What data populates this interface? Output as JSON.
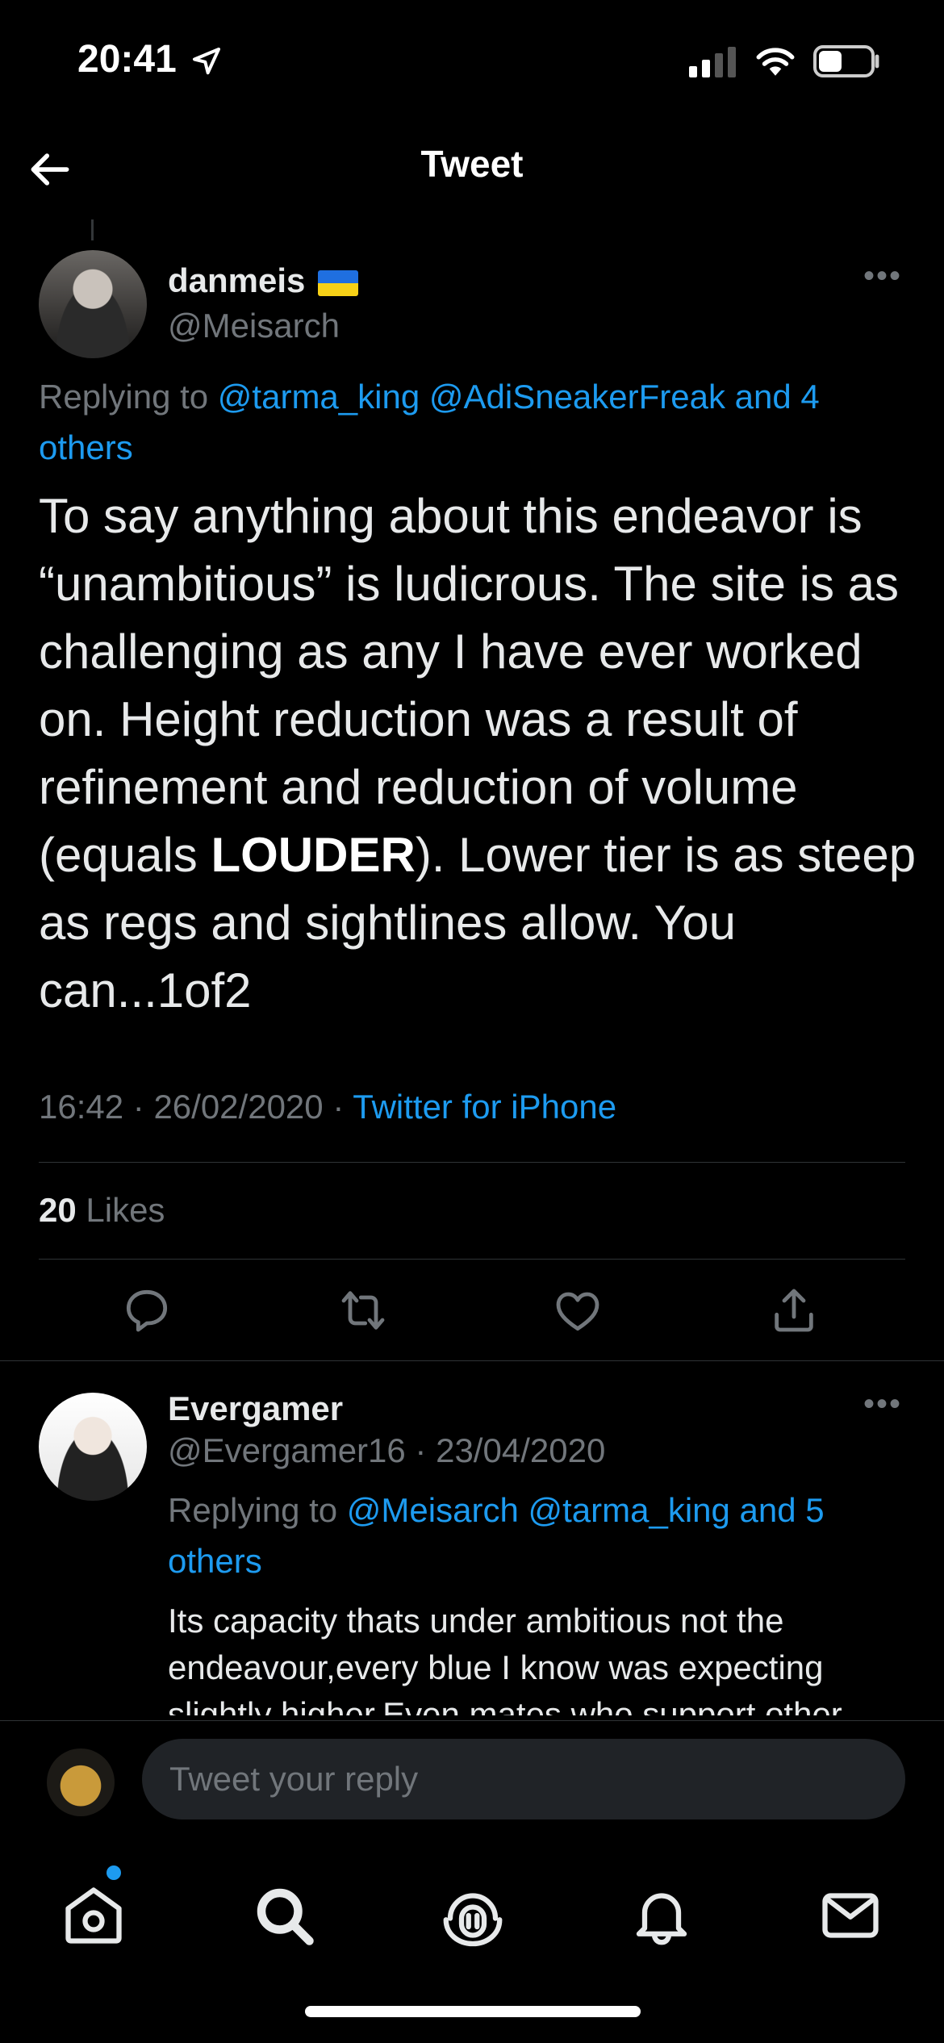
{
  "status_bar": {
    "time": "20:41",
    "battery_level": 0.45
  },
  "nav": {
    "title": "Tweet"
  },
  "tweet": {
    "author_name": "danmeis",
    "handle": "@Meisarch",
    "replying_prefix": "Replying to ",
    "replying_links": "@tarma_king @AdiSneakerFreak and 4 others",
    "text_before_bold": "To say anything about this endeavor is “unambitious” is ludicrous.  The site is as challenging as any I have ever worked on.  Height reduction was a result of refinement and reduction of volume (equals ",
    "text_bold": "LOUDER",
    "text_after_bold": ").  Lower tier is as steep as regs and sightlines allow.  You can...1of2",
    "time": "16:42",
    "date": "26/02/2020",
    "separator": " · ",
    "source": "Twitter for iPhone",
    "likes_count": "20",
    "likes_label": " Likes"
  },
  "reply": {
    "author_name": "Evergamer",
    "handle": "@Evergamer16",
    "separator": " · ",
    "date": "23/04/2020",
    "replying_prefix": "Replying to ",
    "replying_links": "@Meisarch @tarma_king and 5 others",
    "text": "Its capacity thats under ambitious not the endeavour,every blue I know was expecting slightly higher.Even mates who support other"
  },
  "composer": {
    "placeholder": "Tweet your reply"
  },
  "colors": {
    "link": "#1d9bf0",
    "muted": "#71767b",
    "text": "#e7e9ea",
    "background": "#000000"
  },
  "icons": {
    "actions": [
      "reply-icon",
      "retweet-icon",
      "like-icon",
      "share-icon"
    ],
    "tabs": [
      "home-icon",
      "search-icon",
      "spaces-icon",
      "notifications-icon",
      "messages-icon"
    ]
  }
}
